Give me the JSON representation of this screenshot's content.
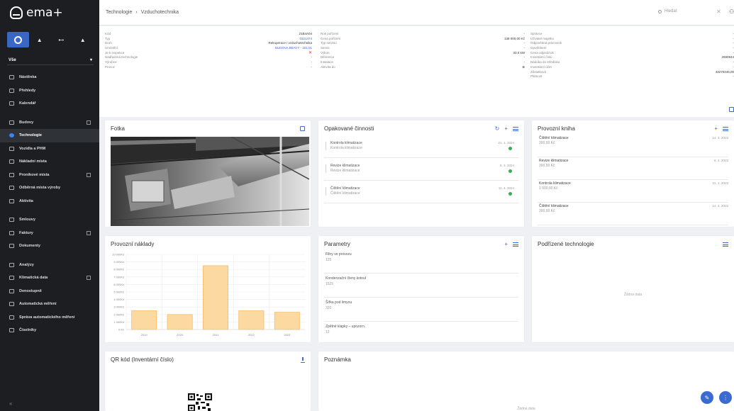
{
  "app": {
    "logo_text": "ema+"
  },
  "sidebar": {
    "filter_label": "Vše",
    "items": [
      {
        "label": "Nástěnka"
      },
      {
        "label": "Přehledy"
      },
      {
        "label": "Kalendář"
      },
      {
        "label": "Budovy"
      },
      {
        "label": "Technologie",
        "active": true
      },
      {
        "label": "Vozidla a PHM"
      },
      {
        "label": "Nákladní místa"
      },
      {
        "label": "Pronikové místa"
      },
      {
        "label": "Odběrná místa výroby"
      },
      {
        "label": "Aktivita"
      },
      {
        "label": "Smlouvy"
      },
      {
        "label": "Faktury"
      },
      {
        "label": "Dokumenty"
      },
      {
        "label": "Analýzy"
      },
      {
        "label": "Klimatická data"
      },
      {
        "label": "Denostupně"
      },
      {
        "label": "Automatická měření"
      },
      {
        "label": "Správa automatického měření"
      },
      {
        "label": "Číselníky"
      }
    ],
    "collapse_glyph": "«"
  },
  "header": {
    "breadcrumb": [
      "Technologie",
      "›",
      "Vzduchotechnika"
    ],
    "search_placeholder": "Hledat",
    "close_glyph": "✕"
  },
  "info": {
    "col1": [
      {
        "label": "Kód",
        "value": "21B4A04"
      },
      {
        "label": "Typ",
        "value": "0321474",
        "link": true
      },
      {
        "label": "Druh",
        "value": "Rekuperace / vzduchotechnika"
      },
      {
        "label": "Umístění",
        "value": "BUDOVA BEAVY - 101.01",
        "link": true
      },
      {
        "label": "Je k inspekce",
        "value": "✕",
        "red": true
      },
      {
        "label": "Nadřazená technologie",
        "value": "-"
      },
      {
        "label": "Výrobce",
        "value": "-"
      },
      {
        "label": "Provoz",
        "value": "-"
      }
    ],
    "col2": [
      {
        "label": "Rok pořízení",
        "value": "-"
      },
      {
        "label": "Cena pořízení",
        "value": "138 000,00 Kč"
      },
      {
        "label": "Typ servisu",
        "value": "-"
      },
      {
        "label": "Servis",
        "value": "-"
      },
      {
        "label": "Výkon",
        "value": "33,0 kW"
      },
      {
        "label": "Diference",
        "value": "-"
      },
      {
        "label": "Instalace",
        "value": "-"
      },
      {
        "label": "Aktivita do",
        "value": "⊕"
      }
    ],
    "col3": [
      {
        "label": "Správce",
        "value": "-"
      },
      {
        "label": "Uživatel majetku",
        "value": "-"
      },
      {
        "label": "Odpovědná pracovník",
        "value": "-"
      },
      {
        "label": "Opotřebení",
        "value": "-"
      },
      {
        "label": "Cena odpisů/rok",
        "value": "-"
      },
      {
        "label": "Inventární číslo",
        "value": "2690944"
      },
      {
        "label": "Nádoba do středisku",
        "value": "-"
      },
      {
        "label": "Inventární účet",
        "value": "-"
      },
      {
        "label": "Zůstatková",
        "value": "43270445,00"
      },
      {
        "label": "Platnost",
        "value": "-"
      }
    ]
  },
  "cards": {
    "photo": {
      "title": "Fotka"
    },
    "recurring": {
      "title": "Opakované činnosti",
      "tasks": [
        {
          "title": "Kontrola klimatizace",
          "subtitle": "Kontrola klimatizace",
          "date": "21. 1. 2024"
        },
        {
          "title": "Revize klimatizace",
          "subtitle": "Revize klimatizace",
          "date": "8. 2. 2024"
        },
        {
          "title": "Čištění klimatizace",
          "subtitle": "Čištění klimatizace",
          "date": "11. 4. 2024"
        }
      ]
    },
    "logbook": {
      "title": "Provozní kniha",
      "entries": [
        {
          "title": "Čištění klimatizace",
          "amount": "300,00 Kč",
          "date": "14. 3. 2023"
        },
        {
          "title": "Revize klimatizace",
          "amount": "300,00 Kč",
          "date": "8. 2. 2023"
        },
        {
          "title": "Kontrola klimatizace",
          "amount": "1 000,00 Kč",
          "date": "21. 1. 2023"
        },
        {
          "title": "Čištění klimatizace",
          "amount": "300,00 Kč",
          "date": "14. 4. 2022"
        }
      ]
    },
    "costs": {
      "title": "Provozní náklady"
    },
    "parameters": {
      "title": "Parametry",
      "items": [
        {
          "label": "Filtry ve provozu",
          "value": "125"
        },
        {
          "label": "Kondenzační členy kotoul",
          "value": "1525"
        },
        {
          "label": "Šířka pod limyou",
          "value": "320"
        },
        {
          "label": "Zpětné klapky – upozorn.",
          "value": "12"
        }
      ]
    },
    "children": {
      "title": "Podřízené technologie",
      "empty": "Žádná data"
    },
    "qr": {
      "title": "QR kód (Inventární číslo)"
    },
    "note": {
      "title": "Poznámka",
      "empty": "Žádná data"
    }
  },
  "fabs": {
    "edit_glyph": "✎",
    "more_glyph": "⋮"
  },
  "chart_data": {
    "type": "bar",
    "categories": [
      "2019",
      "2020",
      "2021",
      "2022",
      "2023"
    ],
    "values": [
      2500,
      2000,
      8500,
      2500,
      2300
    ],
    "yticks": [
      "0 Kč",
      "1 000Kč",
      "2 000Kč",
      "3 000Kč",
      "4 000Kč",
      "5 000Kč",
      "6 000Kč",
      "7 000Kč",
      "8 000Kč",
      "9 000Kč",
      "10 000Kč"
    ],
    "ylim": [
      0,
      10000
    ],
    "grid": true,
    "bar_color": "#fbd9a0",
    "bar_stroke": "#f3b04d"
  }
}
